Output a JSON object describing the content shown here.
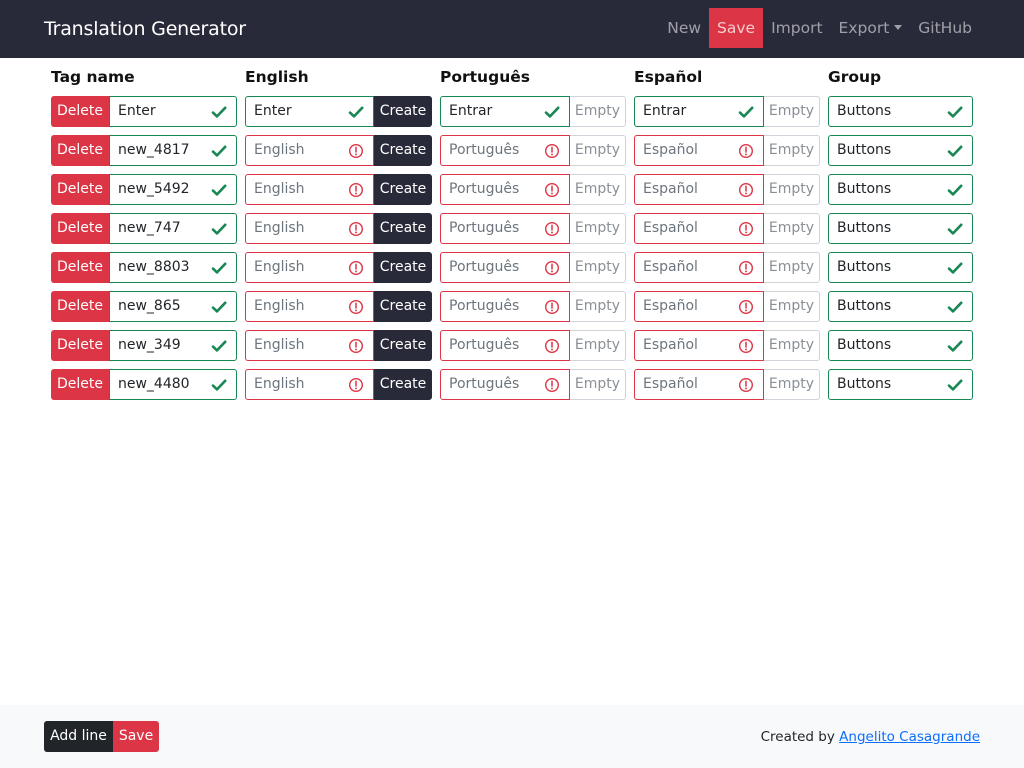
{
  "app": {
    "title": "Translation Generator"
  },
  "nav": {
    "items": [
      "New",
      "Save",
      "Import",
      "Export",
      "GitHub"
    ]
  },
  "columns": [
    "Tag name",
    "English",
    "Português",
    "Español",
    "Group"
  ],
  "labels": {
    "delete": "Delete",
    "create": "Create",
    "empty": "Empty"
  },
  "placeholders": {
    "english": "English",
    "portugues": "Português",
    "espanol": "Español"
  },
  "rows": [
    {
      "tag": "Enter",
      "english": "Enter",
      "portugues": "Entrar",
      "espanol": "Entrar",
      "group": "Buttons"
    },
    {
      "tag": "new_4817",
      "english": "",
      "portugues": "",
      "espanol": "",
      "group": "Buttons"
    },
    {
      "tag": "new_5492",
      "english": "",
      "portugues": "",
      "espanol": "",
      "group": "Buttons"
    },
    {
      "tag": "new_747",
      "english": "",
      "portugues": "",
      "espanol": "",
      "group": "Buttons"
    },
    {
      "tag": "new_8803",
      "english": "",
      "portugues": "",
      "espanol": "",
      "group": "Buttons"
    },
    {
      "tag": "new_865",
      "english": "",
      "portugues": "",
      "espanol": "",
      "group": "Buttons"
    },
    {
      "tag": "new_349",
      "english": "",
      "portugues": "",
      "espanol": "",
      "group": "Buttons"
    },
    {
      "tag": "new_4480",
      "english": "",
      "portugues": "",
      "espanol": "",
      "group": "Buttons"
    }
  ],
  "footer": {
    "add_line": "Add line",
    "save": "Save",
    "credit_prefix": "Created by",
    "credit_name": "Angelito Casagrande"
  },
  "colors": {
    "navbar": "#282a3a",
    "danger": "#dc3545",
    "success": "#198754",
    "dark": "#212529",
    "link": "#0d6efd"
  },
  "icons": {
    "valid": "check-icon",
    "invalid": "exclamation-circle-icon",
    "dropdown": "caret-down-icon"
  }
}
